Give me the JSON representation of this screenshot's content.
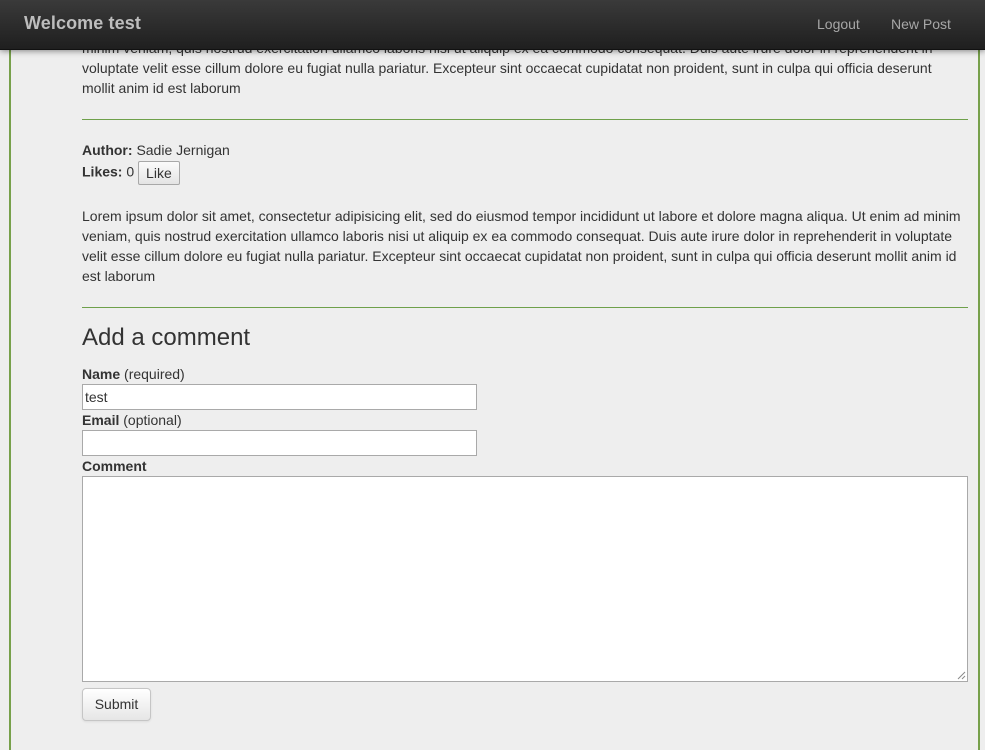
{
  "navbar": {
    "brand": "Welcome test",
    "logout_label": "Logout",
    "new_post_label": "New Post"
  },
  "previous_post": {
    "text": "minim veniam, quis nostrud exercitation ullamco laboris nisi ut aliquip ex ea commodo consequat. Duis aute irure dolor in reprehenderit in voluptate velit esse cillum dolore eu fugiat nulla pariatur. Excepteur sint occaecat cupidatat non proident, sunt in culpa qui officia deserunt mollit anim id est laborum"
  },
  "post": {
    "author_label": "Author:",
    "author": "Sadie Jernigan",
    "likes_label": "Likes:",
    "likes": "0",
    "like_button": "Like",
    "body": "Lorem ipsum dolor sit amet, consectetur adipisicing elit, sed do eiusmod tempor incididunt ut labore et dolore magna aliqua. Ut enim ad minim veniam, quis nostrud exercitation ullamco laboris nisi ut aliquip ex ea commodo consequat. Duis aute irure dolor in reprehenderit in voluptate velit esse cillum dolore eu fugiat nulla pariatur. Excepteur sint occaecat cupidatat non proident, sunt in culpa qui officia deserunt mollit anim id est laborum"
  },
  "comment_form": {
    "heading": "Add a comment",
    "name_label": "Name",
    "name_note": "(required)",
    "name_value": "test",
    "email_label": "Email",
    "email_note": "(optional)",
    "email_value": "",
    "comment_label": "Comment",
    "comment_value": "",
    "submit_label": "Submit"
  },
  "colors": {
    "accent_green": "#77a04b",
    "navbar": "#2b2b2b",
    "background": "#eeeeee"
  }
}
